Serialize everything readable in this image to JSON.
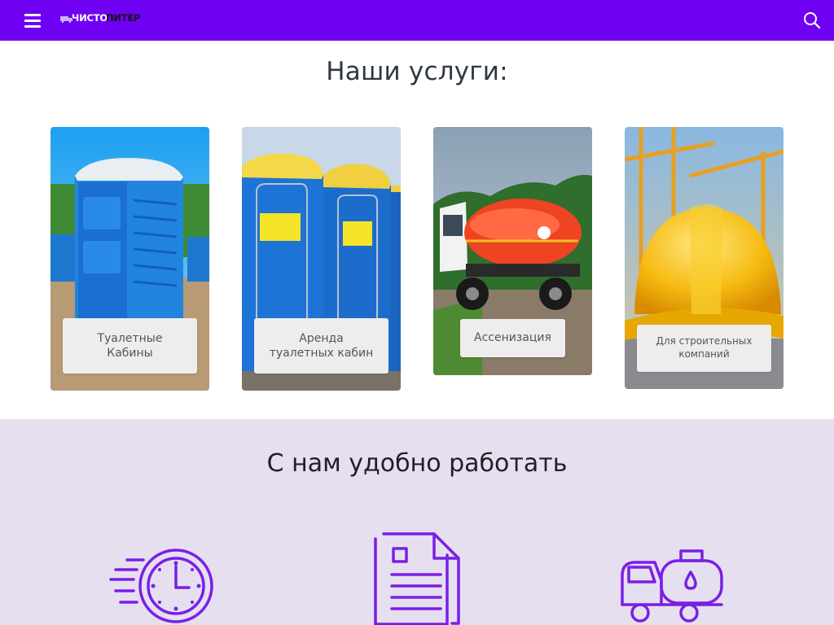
{
  "header": {
    "logo_text_a": "ЧИСТО",
    "logo_text_b": "ПИТЕР",
    "menu_icon": "hamburger-menu-icon",
    "search_icon": "search-icon",
    "bar_color": "#7000f2"
  },
  "services": {
    "title": "Наши услуги:",
    "cards": [
      {
        "label": "Туалетные Кабины",
        "image": "blue portable toilet cabin"
      },
      {
        "label": "Аренда туалетных кабин",
        "image": "row of blue portable toilets"
      },
      {
        "label": "Ассенизация",
        "image": "red vacuum tanker truck"
      },
      {
        "label": "Для строительных компаний",
        "image": "yellow hard hat and cranes"
      }
    ]
  },
  "benefits": {
    "title": "С нам удобно работать",
    "icons": [
      "fast-clock-icon",
      "document-icon",
      "tanker-truck-icon"
    ],
    "accent_color": "#7a1fe6",
    "background": "#e5dff0"
  }
}
